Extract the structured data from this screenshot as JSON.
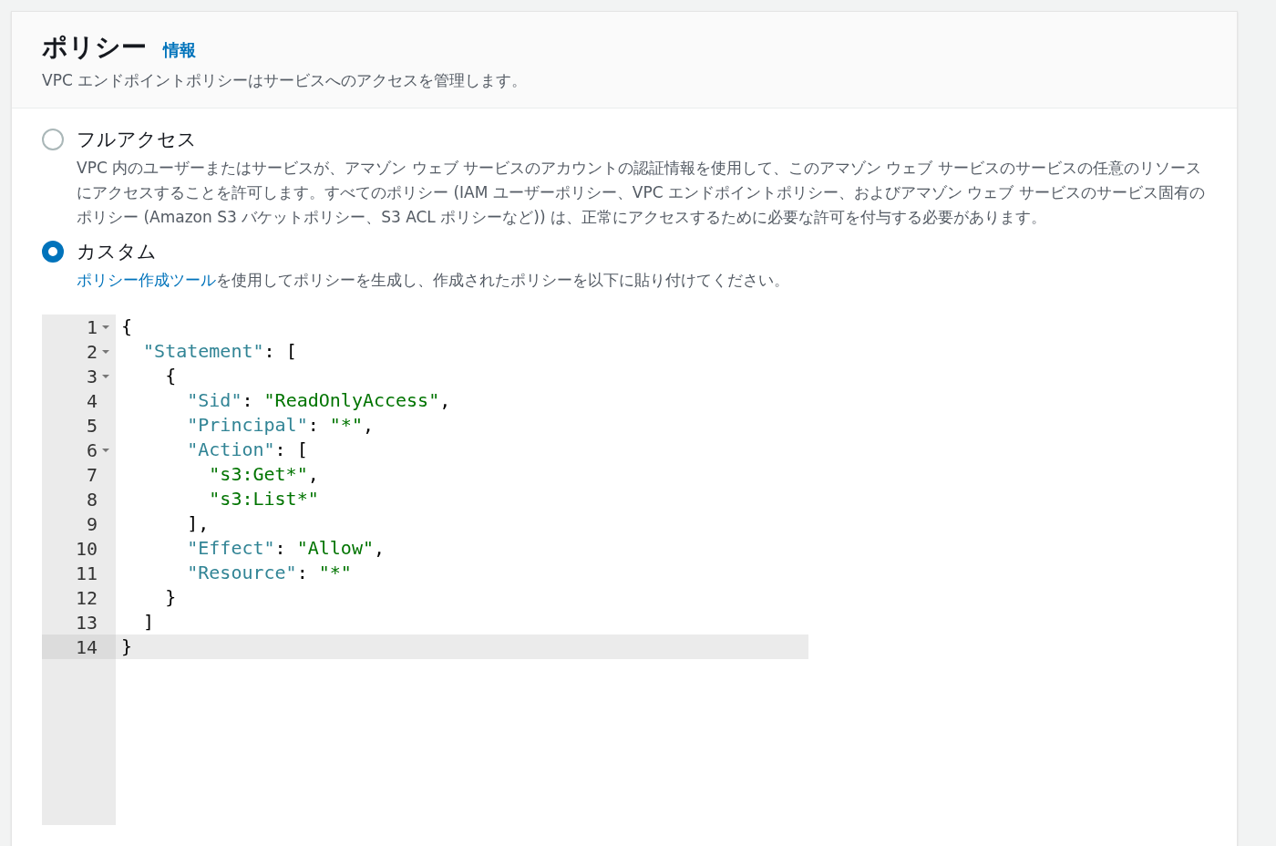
{
  "header": {
    "title": "ポリシー",
    "info_link": "情報",
    "description": "VPC エンドポイントポリシーはサービスへのアクセスを管理します。"
  },
  "options": [
    {
      "label": "フルアクセス",
      "selected": false,
      "description": "VPC 内のユーザーまたはサービスが、アマゾン ウェブ サービスのアカウントの認証情報を使用して、このアマゾン ウェブ サービスのサービスの任意のリソースにアクセスすることを許可します。すべてのポリシー (IAM ユーザーポリシー、VPC エンドポイントポリシー、およびアマゾン ウェブ サービスのサービス固有のポリシー (Amazon S3 バケットポリシー、S3 ACL ポリシーなど)) は、正常にアクセスするために必要な許可を付与する必要があります。"
    },
    {
      "label": "カスタム",
      "selected": true,
      "link": "ポリシー作成ツール",
      "description": "を使用してポリシーを生成し、作成されたポリシーを以下に貼り付けてください。"
    }
  ],
  "editor": {
    "lines": [
      {
        "number": "1",
        "foldable": true,
        "active": false,
        "tokens": [
          {
            "kind": "punct",
            "text": "{"
          }
        ]
      },
      {
        "number": "2",
        "foldable": true,
        "active": false,
        "tokens": [
          {
            "kind": "key",
            "text": "  \"Statement\""
          },
          {
            "kind": "punct",
            "text": ": ["
          }
        ]
      },
      {
        "number": "3",
        "foldable": true,
        "active": false,
        "tokens": [
          {
            "kind": "punct",
            "text": "    {"
          }
        ]
      },
      {
        "number": "4",
        "foldable": false,
        "active": false,
        "tokens": [
          {
            "kind": "key",
            "text": "      \"Sid\""
          },
          {
            "kind": "punct",
            "text": ": "
          },
          {
            "kind": "string",
            "text": "\"ReadOnlyAccess\""
          },
          {
            "kind": "punct",
            "text": ","
          }
        ]
      },
      {
        "number": "5",
        "foldable": false,
        "active": false,
        "tokens": [
          {
            "kind": "key",
            "text": "      \"Principal\""
          },
          {
            "kind": "punct",
            "text": ": "
          },
          {
            "kind": "string",
            "text": "\"*\""
          },
          {
            "kind": "punct",
            "text": ","
          }
        ]
      },
      {
        "number": "6",
        "foldable": true,
        "active": false,
        "tokens": [
          {
            "kind": "key",
            "text": "      \"Action\""
          },
          {
            "kind": "punct",
            "text": ": ["
          }
        ]
      },
      {
        "number": "7",
        "foldable": false,
        "active": false,
        "tokens": [
          {
            "kind": "string",
            "text": "        \"s3:Get*\""
          },
          {
            "kind": "punct",
            "text": ","
          }
        ]
      },
      {
        "number": "8",
        "foldable": false,
        "active": false,
        "tokens": [
          {
            "kind": "string",
            "text": "        \"s3:List*\""
          }
        ]
      },
      {
        "number": "9",
        "foldable": false,
        "active": false,
        "tokens": [
          {
            "kind": "punct",
            "text": "      ],"
          }
        ]
      },
      {
        "number": "10",
        "foldable": false,
        "active": false,
        "tokens": [
          {
            "kind": "key",
            "text": "      \"Effect\""
          },
          {
            "kind": "punct",
            "text": ": "
          },
          {
            "kind": "string",
            "text": "\"Allow\""
          },
          {
            "kind": "punct",
            "text": ","
          }
        ]
      },
      {
        "number": "11",
        "foldable": false,
        "active": false,
        "tokens": [
          {
            "kind": "key",
            "text": "      \"Resource\""
          },
          {
            "kind": "punct",
            "text": ": "
          },
          {
            "kind": "string",
            "text": "\"*\""
          }
        ]
      },
      {
        "number": "12",
        "foldable": false,
        "active": false,
        "tokens": [
          {
            "kind": "punct",
            "text": "    }"
          }
        ]
      },
      {
        "number": "13",
        "foldable": false,
        "active": false,
        "tokens": [
          {
            "kind": "punct",
            "text": "  ]"
          }
        ]
      },
      {
        "number": "14",
        "foldable": false,
        "active": true,
        "tokens": [
          {
            "kind": "punct",
            "text": "}"
          }
        ]
      }
    ]
  }
}
